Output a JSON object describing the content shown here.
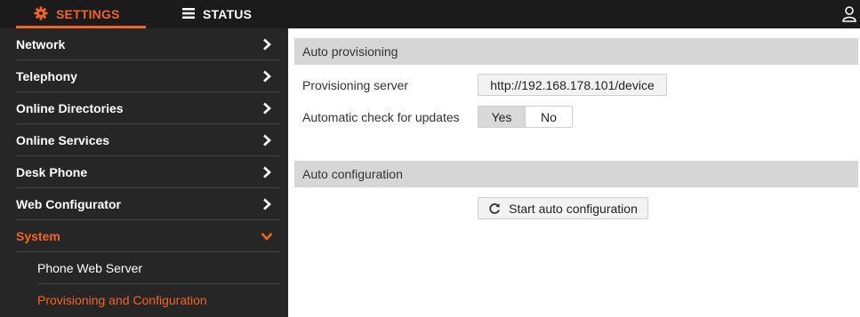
{
  "topbar": {
    "tabs": [
      {
        "label": "SETTINGS",
        "icon": "gear-icon",
        "active": true
      },
      {
        "label": "STATUS",
        "icon": "list-icon",
        "active": false
      }
    ],
    "user_icon": "user-icon"
  },
  "colors": {
    "accent": "#f26522",
    "topbar": "#1b1b1b",
    "sidebar": "#262626",
    "section_header": "#d6d6d6"
  },
  "sidebar": {
    "items": [
      {
        "label": "Network",
        "icon": "chevron-right-icon"
      },
      {
        "label": "Telephony",
        "icon": "chevron-right-icon"
      },
      {
        "label": "Online Directories",
        "icon": "chevron-right-icon"
      },
      {
        "label": "Online Services",
        "icon": "chevron-right-icon"
      },
      {
        "label": "Desk Phone",
        "icon": "chevron-right-icon"
      },
      {
        "label": "Web Configurator",
        "icon": "chevron-right-icon"
      },
      {
        "label": "System",
        "icon": "chevron-down-icon",
        "expanded": true
      },
      {
        "label": "Phone Web Server",
        "sub": true
      },
      {
        "label": "Provisioning and Configuration",
        "sub": true,
        "active": true
      }
    ]
  },
  "main": {
    "auto_provisioning": {
      "title": "Auto provisioning",
      "server_label": "Provisioning server",
      "server_value": "http://192.168.178.101/device",
      "updates_label": "Automatic check for updates",
      "yes_label": "Yes",
      "no_label": "No",
      "selected": "Yes"
    },
    "auto_configuration": {
      "title": "Auto configuration",
      "start_label": "Start auto configuration",
      "start_icon": "refresh-icon"
    }
  }
}
